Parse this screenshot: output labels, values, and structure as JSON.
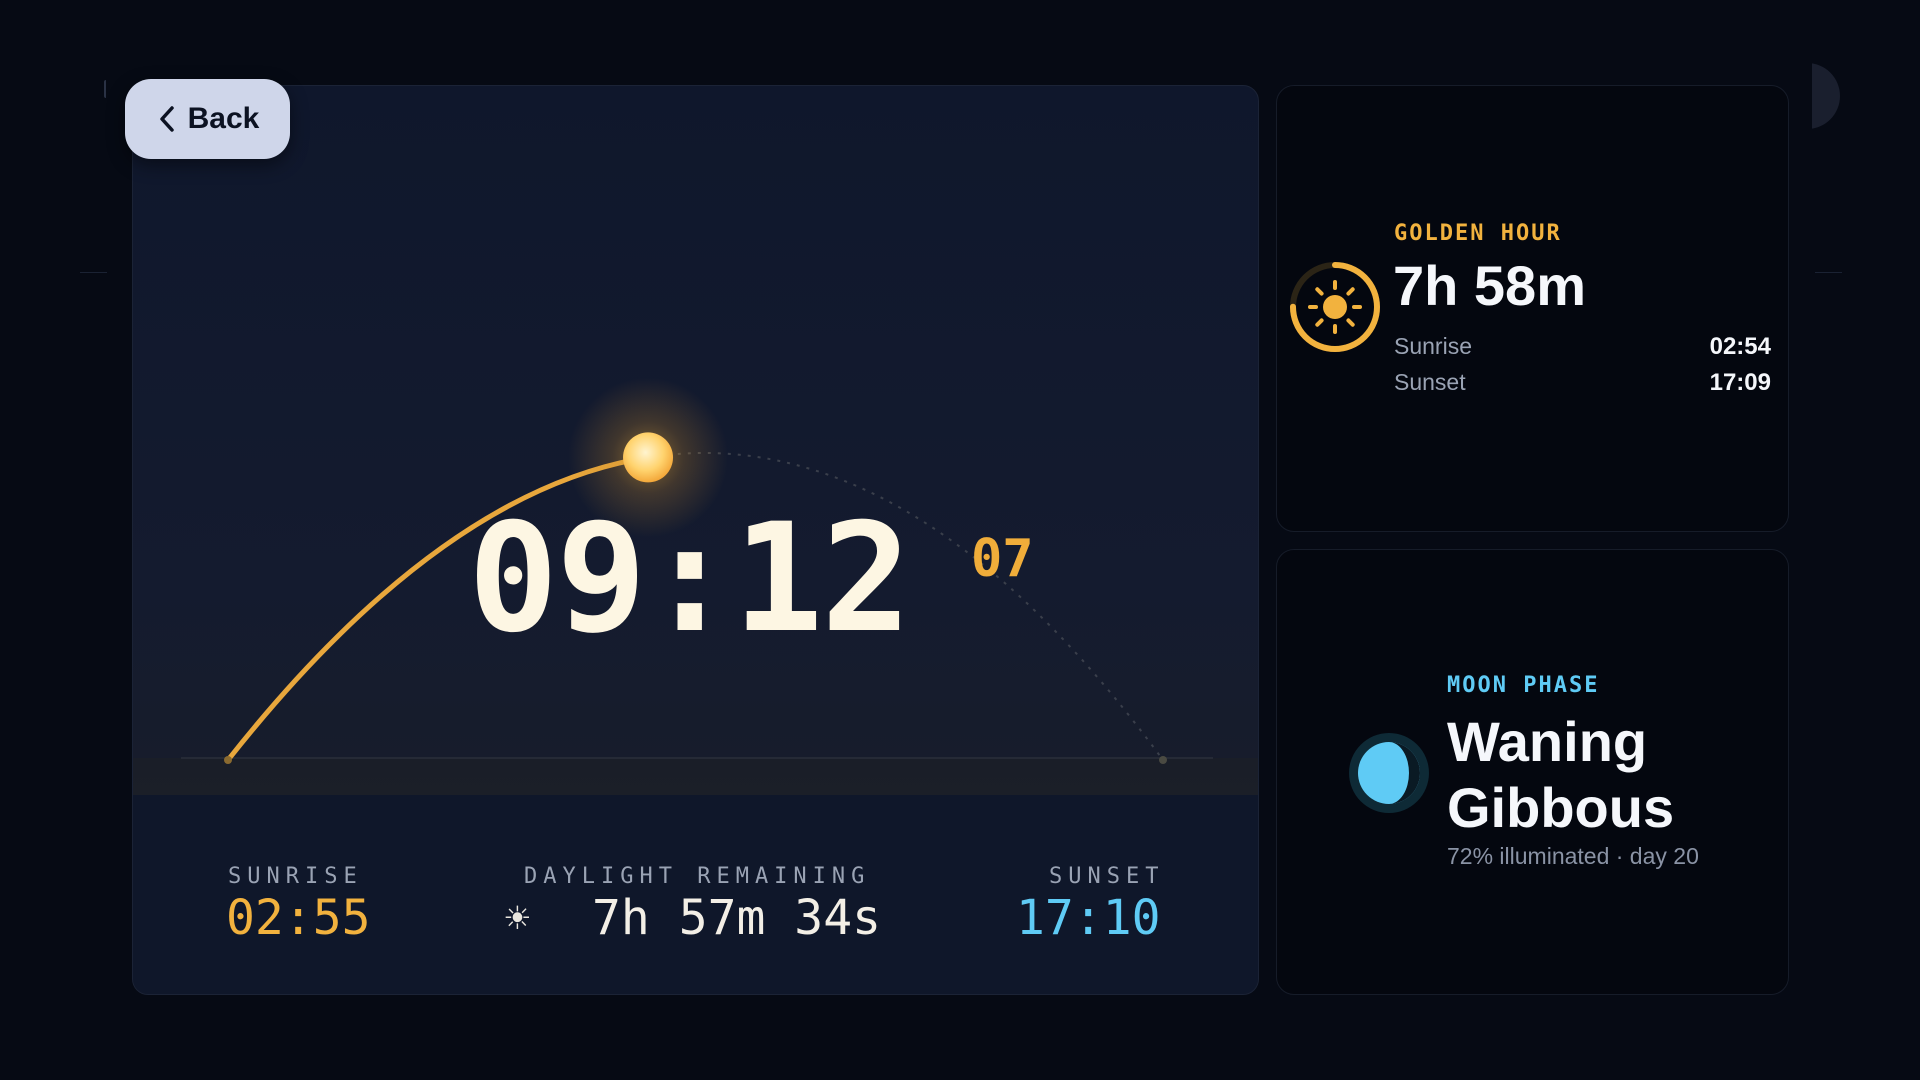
{
  "back_button": {
    "label": "Back"
  },
  "clock": {
    "hours_minutes": "09:12",
    "seconds": "07"
  },
  "daylight": {
    "sunrise_label": "SUNRISE",
    "sunrise_time": "02:55",
    "remaining_label": "DAYLIGHT REMAINING",
    "remaining_value": "7h 57m 34s",
    "sunset_label": "SUNSET",
    "sunset_time": "17:10",
    "sun_progress": 0.44
  },
  "golden_hour": {
    "title": "GOLDEN HOUR",
    "duration": "7h 58m",
    "rows": [
      {
        "label": "Sunrise",
        "value": "02:54"
      },
      {
        "label": "Sunset",
        "value": "17:09"
      }
    ],
    "ring_progress": 0.75
  },
  "moon": {
    "title": "MOON PHASE",
    "phase_name": "Waning Gibbous",
    "details": "72% illuminated · day 20",
    "illumination": 0.72
  },
  "colors": {
    "accent_gold": "#f2b23e",
    "accent_cyan": "#5fcbf5",
    "background": "#060a14"
  },
  "icons": {
    "back": "chevron-left-icon",
    "sun": "sun-icon",
    "moon": "moon-icon",
    "daylight": "sun-small-icon"
  }
}
